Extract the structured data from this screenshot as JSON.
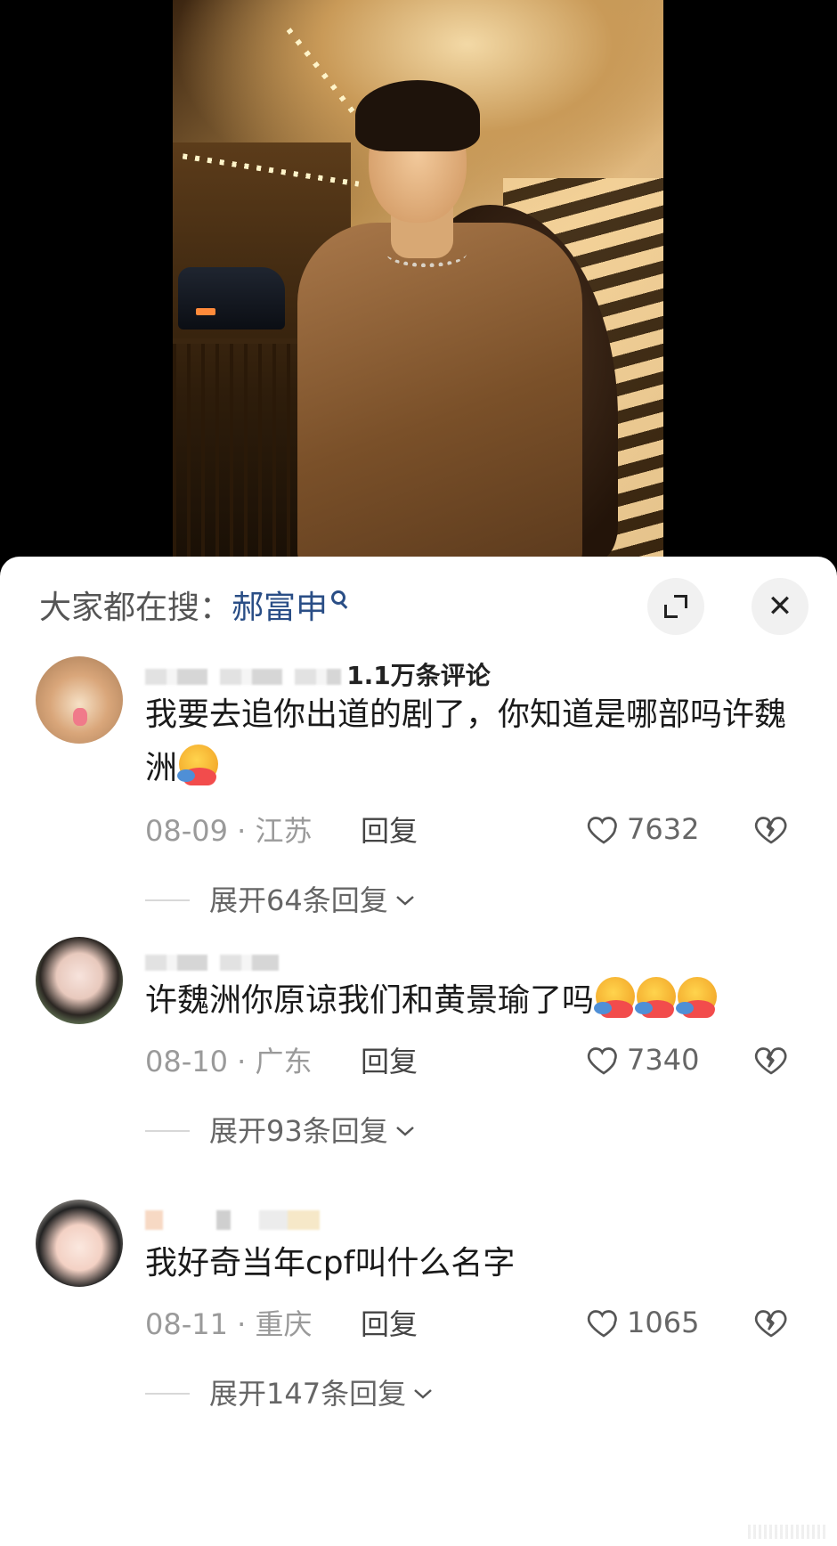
{
  "search": {
    "prefix": "大家都在搜：",
    "term": "郝富申"
  },
  "comments_header": {
    "count_label": "1.1万条评论"
  },
  "comments": [
    {
      "text": "我要去追你出道的剧了，你知道是哪部吗许魏洲",
      "emoji_count": 1,
      "date": "08-09",
      "location": "江苏",
      "reply_label": "回复",
      "likes": "7632",
      "expand_label": "展开64条回复"
    },
    {
      "text": "许魏洲你原谅我们和黄景瑜了吗",
      "emoji_count": 3,
      "date": "08-10",
      "location": "广东",
      "reply_label": "回复",
      "likes": "7340",
      "expand_label": "展开93条回复"
    },
    {
      "text": "我好奇当年cpf叫什么名字",
      "emoji_count": 0,
      "date": "08-11",
      "location": "重庆",
      "reply_label": "回复",
      "likes": "1065",
      "expand_label": "展开147条回复"
    }
  ],
  "colors": {
    "search_term": "#2a4e86",
    "meta_text": "#9a9a9a",
    "panel_bg": "#ffffff"
  },
  "icons": [
    "search-icon",
    "expand-icon",
    "close-icon",
    "heart-icon",
    "dislike-icon",
    "chevron-down-icon"
  ]
}
